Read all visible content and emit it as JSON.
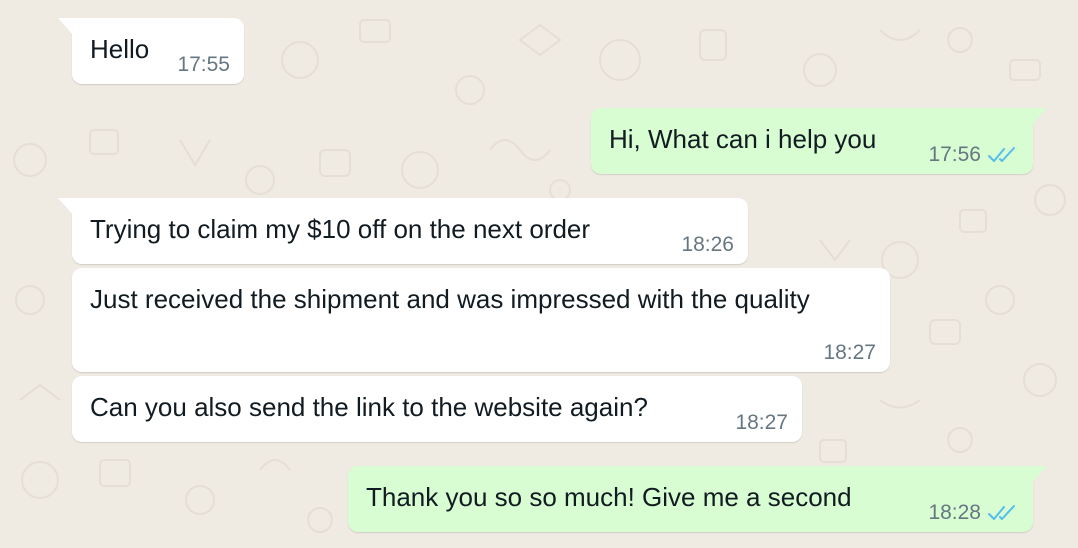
{
  "colors": {
    "wallpaper": "#efeae2",
    "incoming_bubble": "#ffffff",
    "outgoing_bubble": "#d9fdd3",
    "timestamp": "#667781",
    "read_ticks": "#53bdeb"
  },
  "messages": [
    {
      "direction": "incoming",
      "text": "Hello",
      "time": "17:55"
    },
    {
      "direction": "outgoing",
      "text": "Hi, What can i help you",
      "time": "17:56",
      "status_icon": "double-check-read-icon"
    },
    {
      "direction": "incoming",
      "text": "Trying to claim my $10 off on the next order",
      "time": "18:26"
    },
    {
      "direction": "incoming",
      "text": "Just received the shipment and was impressed with the quality",
      "time": "18:27"
    },
    {
      "direction": "incoming",
      "text": "Can you also send the link to the website again?",
      "time": "18:27"
    },
    {
      "direction": "outgoing",
      "text": "Thank you so so much! Give me a second",
      "time": "18:28",
      "status_icon": "double-check-read-icon"
    }
  ]
}
